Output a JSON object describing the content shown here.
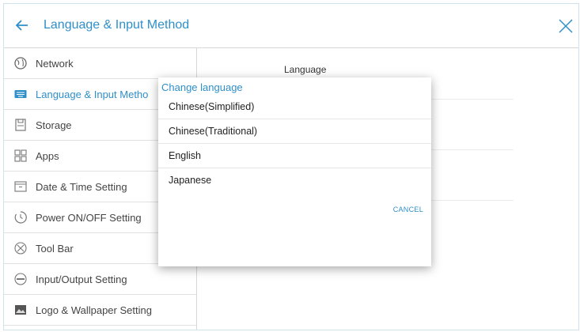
{
  "header": {
    "title": "Language & Input Method",
    "back_icon": "arrow-left-icon",
    "close_icon": "close-x-icon"
  },
  "sidebar": {
    "items": [
      {
        "label": "Network",
        "icon": "globe-icon"
      },
      {
        "label": "Language & Input Metho",
        "icon": "keyboard-icon",
        "active": true
      },
      {
        "label": "Storage",
        "icon": "storage-icon"
      },
      {
        "label": "Apps",
        "icon": "apps-grid-icon"
      },
      {
        "label": "Date & Time Setting",
        "icon": "calendar-icon"
      },
      {
        "label": "Power ON/OFF Setting",
        "icon": "power-timer-icon"
      },
      {
        "label": "Tool Bar",
        "icon": "toolbar-icon"
      },
      {
        "label": "Input/Output Setting",
        "icon": "input-output-icon"
      },
      {
        "label": "Logo & Wallpaper Setting",
        "icon": "image-icon"
      }
    ]
  },
  "main": {
    "language_label": "Language"
  },
  "dialog": {
    "title": "Change language",
    "options": [
      "Chinese(Simplified)",
      "Chinese(Traditional)",
      "English",
      "Japanese"
    ],
    "cancel_label": "CANCEL"
  },
  "colors": {
    "accent": "#2f8fc9",
    "divider": "#e2e2e2"
  }
}
